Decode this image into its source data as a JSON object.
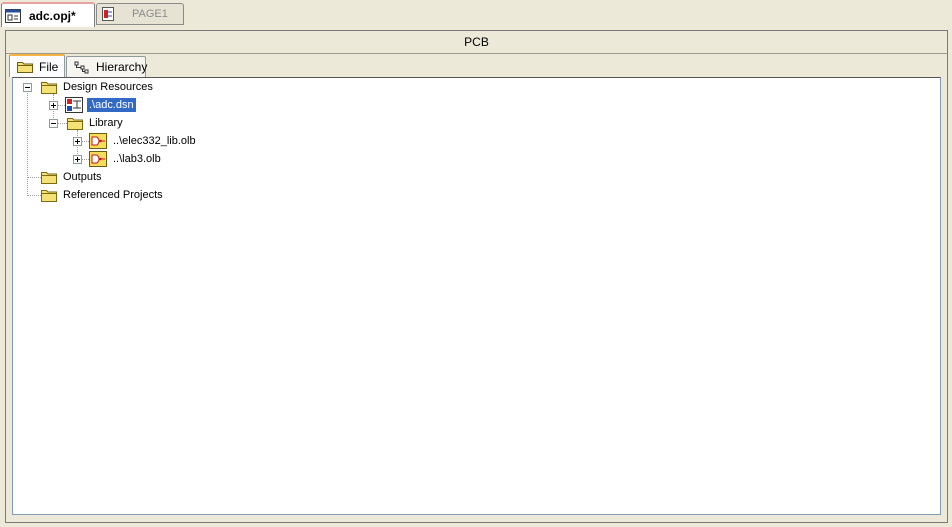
{
  "doc_tabs": [
    {
      "label": "adc.opj*",
      "active": true,
      "icon": "project-window-icon"
    },
    {
      "label": "PAGE1",
      "active": false,
      "icon": "schematic-page-icon"
    }
  ],
  "panel": {
    "title": "PCB",
    "tabs": [
      {
        "label": "File",
        "icon": "folder-icon",
        "active": true
      },
      {
        "label": "Hierarchy",
        "icon": "hierarchy-icon",
        "active": false
      }
    ]
  },
  "tree": {
    "design_resources": "Design Resources",
    "design_file": ".\\adc.dsn",
    "library": "Library",
    "lib1": "..\\elec332_lib.olb",
    "lib2": "..\\lab3.olb",
    "outputs": "Outputs",
    "referenced_projects": "Referenced Projects"
  },
  "colors": {
    "selection": "#316ac5",
    "folder": "#f5e277",
    "window_bg": "#ece9d8",
    "active_tab_accent": "#f3b446"
  }
}
